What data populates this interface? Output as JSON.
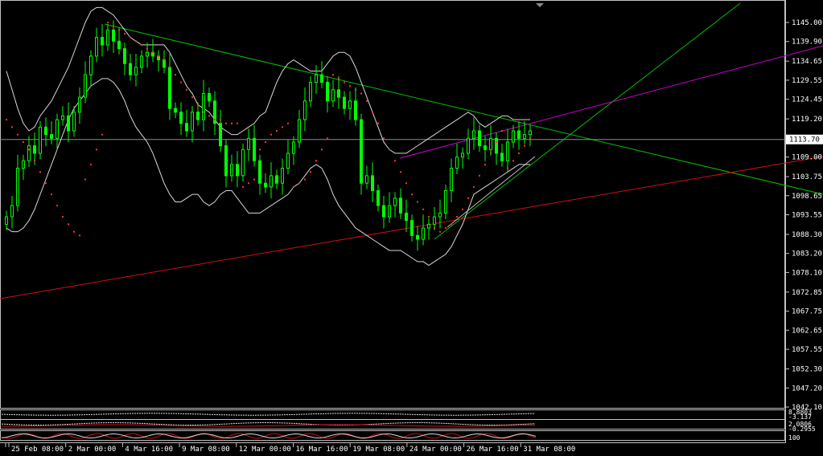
{
  "chart_data": {
    "type": "candlestick",
    "price_axis_labels": [
      "1145.00",
      "1139.90",
      "1134.65",
      "1129.55",
      "1124.45",
      "1119.20",
      "1113.70",
      "1109.00",
      "1103.75",
      "1098.65",
      "1093.55",
      "1088.30",
      "1083.20",
      "1078.10",
      "1072.85",
      "1067.75",
      "1062.65",
      "1057.55",
      "1052.30",
      "1047.20",
      "1042.10"
    ],
    "ylim": [
      1042.1,
      1145.0
    ],
    "current_price": 1113.7,
    "current_price_label": "1113.70",
    "time_axis_labels": [
      "25 Feb 08:00",
      "2 Mar 00:00",
      "4 Mar 16:00",
      "9 Mar 08:00",
      "12 Mar 00:00",
      "16 Mar 16:00",
      "19 Mar 08:00",
      "24 Mar 00:00",
      "26 Mar 16:00",
      "31 Mar 08:00"
    ],
    "sub_indicator_labels": [
      "8.8803",
      "-3.137",
      "2.0806",
      "-0.2955",
      "100"
    ],
    "closes": [
      1093,
      1096,
      1106,
      1108,
      1112,
      1110,
      1117,
      1115,
      1114,
      1119,
      1120,
      1116,
      1121,
      1125,
      1131,
      1136,
      1141,
      1139,
      1143,
      1140,
      1138,
      1134,
      1131,
      1133,
      1136,
      1137,
      1136,
      1135,
      1133,
      1122,
      1121,
      1118,
      1116,
      1121,
      1119,
      1126,
      1124,
      1118,
      1112,
      1104,
      1107,
      1104,
      1111,
      1114,
      1108,
      1102,
      1101,
      1104,
      1102,
      1106,
      1110,
      1113,
      1119,
      1124,
      1129,
      1131,
      1129,
      1124,
      1127,
      1125,
      1122,
      1124,
      1119,
      1102,
      1104,
      1100,
      1096,
      1093,
      1096,
      1098,
      1094,
      1092,
      1088,
      1087,
      1090,
      1091,
      1093,
      1094,
      1100,
      1106,
      1109,
      1110,
      1114,
      1116,
      1112,
      1111,
      1114,
      1110,
      1108,
      1113,
      1116,
      1114,
      1115,
      1116
    ],
    "band_upper": [
      1132,
      1127,
      1122,
      1118,
      1116,
      1117,
      1120,
      1122,
      1124,
      1127,
      1130,
      1133,
      1137,
      1141,
      1145,
      1148,
      1149,
      1149,
      1148,
      1147,
      1145,
      1143,
      1141,
      1140,
      1139,
      1139,
      1139,
      1139,
      1139,
      1137,
      1134,
      1131,
      1128,
      1126,
      1123,
      1122,
      1121,
      1119,
      1117,
      1116,
      1115,
      1115,
      1116,
      1117,
      1118,
      1120,
      1121,
      1125,
      1129,
      1132,
      1134,
      1135,
      1134,
      1133,
      1132,
      1132,
      1132,
      1134,
      1136,
      1137,
      1137,
      1136,
      1133,
      1129,
      1125,
      1121,
      1117,
      1113,
      1111,
      1110,
      1110,
      1110,
      1111,
      1112,
      1113,
      1114,
      1115,
      1116,
      1117,
      1118,
      1119,
      1120,
      1121,
      1120,
      1118,
      1117,
      1118,
      1119,
      1120,
      1120,
      1119,
      1119,
      1119,
      1119
    ],
    "band_lower": [
      1090,
      1089,
      1089,
      1090,
      1092,
      1095,
      1099,
      1103,
      1107,
      1111,
      1115,
      1119,
      1122,
      1124,
      1126,
      1128,
      1129,
      1130,
      1130,
      1129,
      1127,
      1124,
      1120,
      1117,
      1115,
      1113,
      1110,
      1106,
      1102,
      1099,
      1097,
      1097,
      1098,
      1099,
      1099,
      1097,
      1096,
      1097,
      1099,
      1100,
      1100,
      1098,
      1096,
      1094,
      1094,
      1094,
      1095,
      1096,
      1097,
      1098,
      1099,
      1101,
      1102,
      1104,
      1106,
      1107,
      1106,
      1103,
      1099,
      1096,
      1094,
      1092,
      1090,
      1089,
      1088,
      1087,
      1086,
      1085,
      1084,
      1084,
      1084,
      1083,
      1082,
      1081,
      1081,
      1080,
      1081,
      1082,
      1083,
      1085,
      1088,
      1091,
      1095,
      1099,
      1100,
      1101,
      1102,
      1103,
      1104,
      1105,
      1106,
      1107,
      1107,
      1107
    ],
    "sar_points": [
      [
        0,
        1119
      ],
      [
        1,
        1117
      ],
      [
        2,
        1115
      ],
      [
        3,
        1113
      ],
      [
        4,
        1111
      ],
      [
        5,
        1108
      ],
      [
        6,
        1105
      ],
      [
        7,
        1102
      ],
      [
        8,
        1099
      ],
      [
        9,
        1096
      ],
      [
        10,
        1093
      ],
      [
        11,
        1091
      ],
      [
        12,
        1089
      ],
      [
        13,
        1088
      ],
      [
        14,
        1103
      ],
      [
        15,
        1107
      ],
      [
        16,
        1111
      ],
      [
        17,
        1115
      ],
      [
        18,
        1145
      ],
      [
        19,
        1144
      ],
      [
        20,
        1143
      ],
      [
        21,
        1142
      ],
      [
        22,
        1141
      ],
      [
        23,
        1140
      ],
      [
        24,
        1139
      ],
      [
        25,
        1138
      ],
      [
        26,
        1137
      ],
      [
        27,
        1136
      ],
      [
        28,
        1135
      ],
      [
        29,
        1133
      ],
      [
        30,
        1131
      ],
      [
        31,
        1129
      ],
      [
        32,
        1127
      ],
      [
        33,
        1125
      ],
      [
        34,
        1123
      ],
      [
        35,
        1121
      ],
      [
        36,
        1120
      ],
      [
        37,
        1119
      ],
      [
        38,
        1119
      ],
      [
        39,
        1118
      ],
      [
        40,
        1118
      ],
      [
        41,
        1118
      ],
      [
        42,
        1101
      ],
      [
        43,
        1102
      ],
      [
        44,
        1103
      ],
      [
        45,
        1111
      ],
      [
        46,
        1113
      ],
      [
        47,
        1115
      ],
      [
        48,
        1116
      ],
      [
        49,
        1117
      ],
      [
        50,
        1118
      ],
      [
        51,
        1101
      ],
      [
        52,
        1102
      ],
      [
        53,
        1103
      ],
      [
        54,
        1105
      ],
      [
        55,
        1108
      ],
      [
        56,
        1111
      ],
      [
        57,
        1114
      ],
      [
        58,
        1131
      ],
      [
        59,
        1130
      ],
      [
        60,
        1129
      ],
      [
        61,
        1128
      ],
      [
        62,
        1127
      ],
      [
        63,
        1126
      ],
      [
        64,
        1124
      ],
      [
        65,
        1121
      ],
      [
        66,
        1118
      ],
      [
        67,
        1114
      ],
      [
        68,
        1111
      ],
      [
        69,
        1108
      ],
      [
        70,
        1105
      ],
      [
        71,
        1102
      ],
      [
        72,
        1099
      ],
      [
        73,
        1097
      ],
      [
        74,
        1095
      ],
      [
        75,
        1093
      ],
      [
        76,
        1090
      ],
      [
        77,
        1089
      ],
      [
        78,
        1090
      ],
      [
        79,
        1091
      ],
      [
        80,
        1093
      ],
      [
        81,
        1095
      ],
      [
        82,
        1098
      ],
      [
        83,
        1101
      ],
      [
        84,
        1104
      ],
      [
        85,
        1107
      ],
      [
        86,
        1110
      ],
      [
        87,
        1113
      ],
      [
        88,
        1116
      ],
      [
        89,
        1106
      ],
      [
        90,
        1108
      ],
      [
        91,
        1110
      ],
      [
        92,
        1112
      ],
      [
        93,
        1114
      ]
    ]
  }
}
